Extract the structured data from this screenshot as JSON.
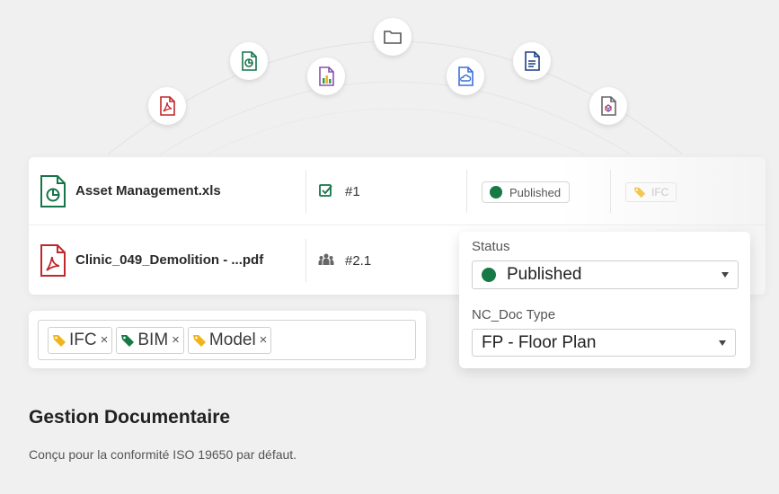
{
  "orbit_icons": [
    {
      "name": "pdf-file-icon",
      "color": "#c0282d"
    },
    {
      "name": "spreadsheet-file-icon",
      "color": "#167548"
    },
    {
      "name": "chart-file-icon",
      "color": "#8a4fb0"
    },
    {
      "name": "folder-icon",
      "color": "#555555"
    },
    {
      "name": "cloud-file-icon",
      "color": "#3b6fd8"
    },
    {
      "name": "document-file-icon",
      "color": "#1e3f84"
    },
    {
      "name": "model-file-icon",
      "color": "#666666"
    }
  ],
  "rows": [
    {
      "file_name": "Asset Management.xls",
      "file_icon": "spreadsheet-file-icon",
      "meta_icon": "checkbox-icon",
      "meta_text": "#1",
      "status": "Published",
      "tag": "IFC"
    },
    {
      "file_name": "Clinic_049_Demolition - ...pdf",
      "file_icon": "pdf-file-icon",
      "meta_icon": "group-icon",
      "meta_text": "#2.1"
    }
  ],
  "tags": [
    {
      "label": "IFC",
      "color": "#f2b41c",
      "remove": "×"
    },
    {
      "label": "BIM",
      "color": "#177a46",
      "remove": "×"
    },
    {
      "label": "Model",
      "color": "#f2b41c",
      "remove": "×"
    }
  ],
  "props": {
    "status_label": "Status",
    "status_value": "Published",
    "status_color": "#177a46",
    "doctype_label": "NC_Doc Type",
    "doctype_value": "FP - Floor Plan"
  },
  "heading": "Gestion Documentaire",
  "subtext": "Conçu pour la conformité ISO 19650 par défaut."
}
